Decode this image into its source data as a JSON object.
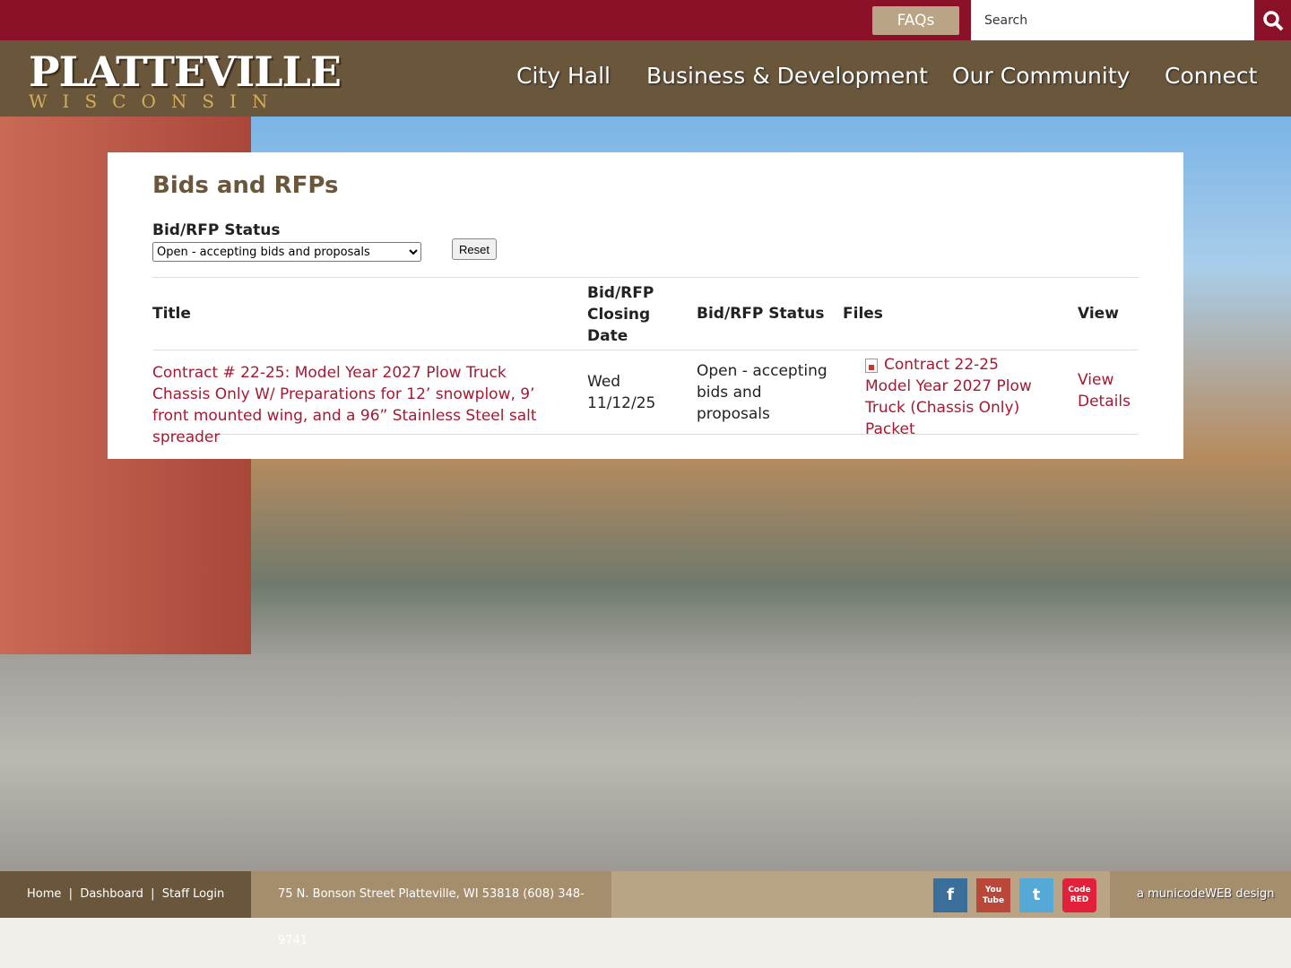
{
  "topbar": {
    "faqs": "FAQs",
    "search_placeholder": "Search"
  },
  "logo": {
    "name": "PLATTEVILLE",
    "state": "WISCONSIN"
  },
  "nav": [
    "City Hall",
    "Business & Development",
    "Our Community",
    "Connect"
  ],
  "page": {
    "title": "Bids and RFPs",
    "filter_label": "Bid/RFP Status",
    "filter_value": "Open - accepting bids and proposals",
    "reset": "Reset"
  },
  "table": {
    "headers": [
      "Title",
      "Bid/RFP Closing Date",
      "Bid/RFP Status",
      "Files",
      "View"
    ],
    "rows": [
      {
        "title": "Contract # 22-25: Model Year 2027 Plow Truck Chassis Only W/ Preparations for 12’ snowplow, 9’ front mounted wing, and a 96” Stainless Steel salt spreader",
        "date": "Wed 11/12/25",
        "status": "Open - accepting bids and proposals",
        "file": "Contract 22-25 Model Year 2027 Plow Truck (Chassis Only) Packet",
        "view": "View Details"
      }
    ]
  },
  "footer": {
    "links": [
      "Home",
      "Dashboard",
      "Staff Login"
    ],
    "address": "75 N. Bonson Street Platteville, WI 53818  (608) 348-9741",
    "credit": "a municodeWEB design",
    "social": [
      "f",
      "You Tube",
      "t",
      "Code RED"
    ]
  }
}
